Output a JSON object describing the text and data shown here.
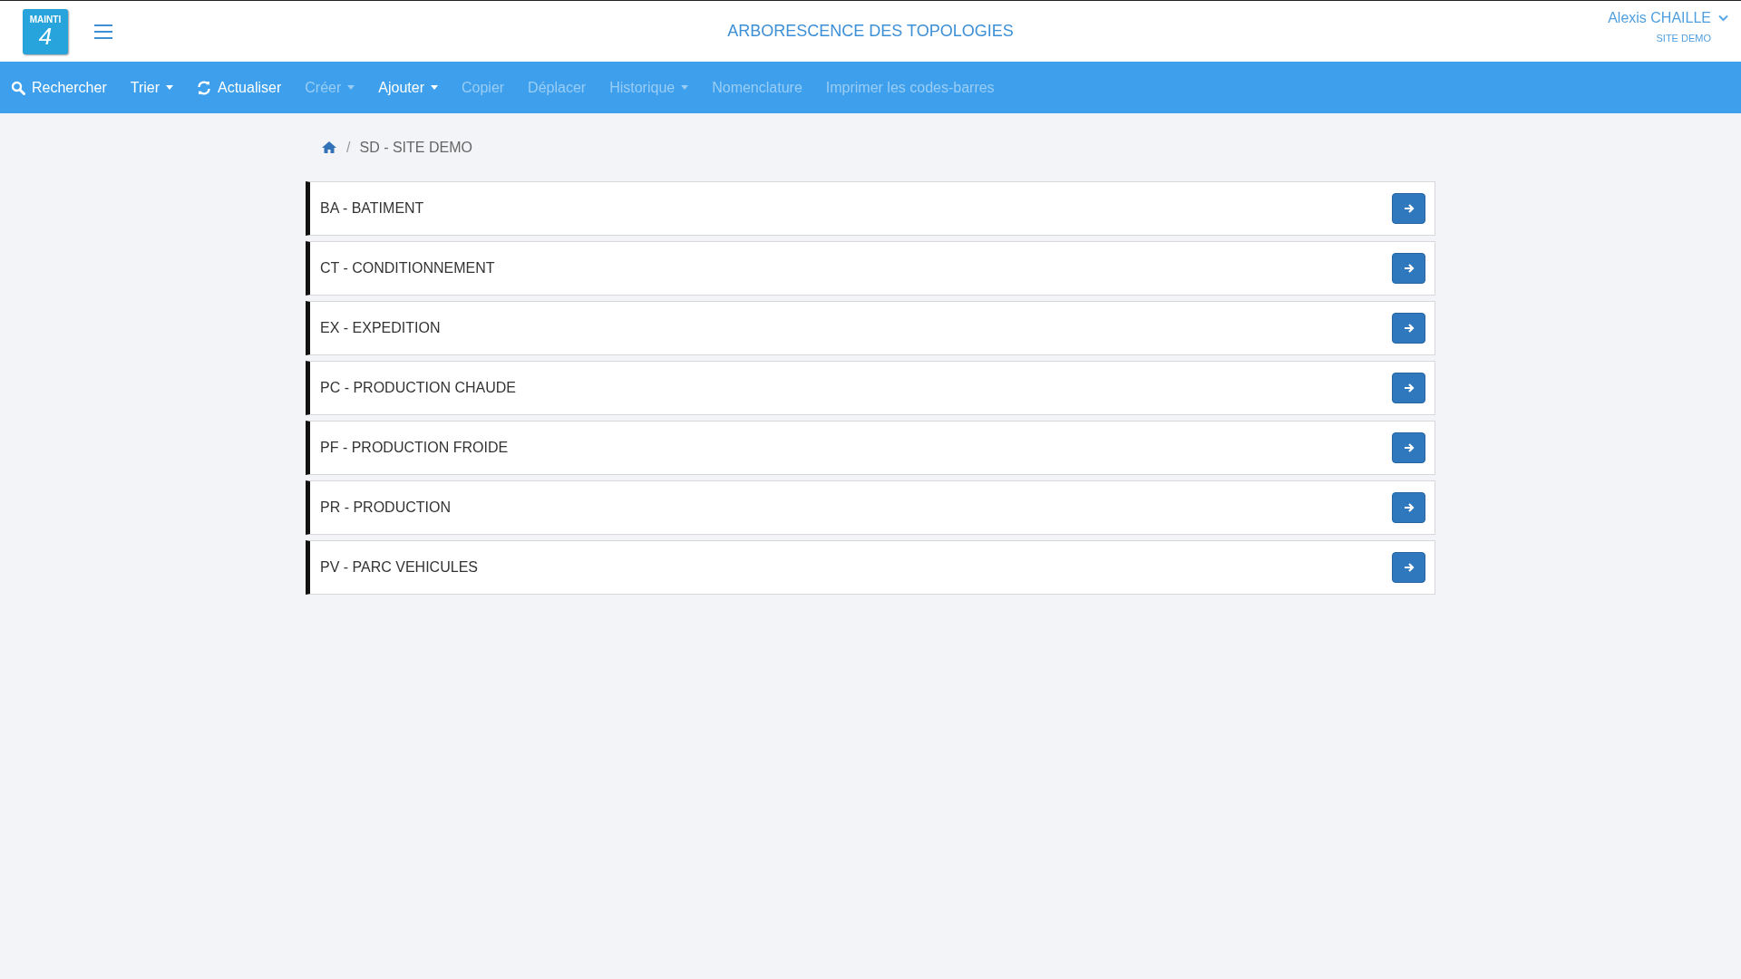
{
  "header": {
    "logo": {
      "text": "MAINTI",
      "number": "4"
    },
    "title": "ARBORESCENCE DES TOPOLOGIES",
    "user": {
      "name": "Alexis CHAILLE",
      "site": "SITE DEMO"
    }
  },
  "toolbar": [
    {
      "label": "Rechercher",
      "kind": "search",
      "dropdown": false,
      "disabled": false
    },
    {
      "label": "Trier",
      "kind": "plain",
      "dropdown": true,
      "disabled": false
    },
    {
      "label": "Actualiser",
      "kind": "refresh",
      "dropdown": false,
      "disabled": false
    },
    {
      "label": "Créer",
      "kind": "plain",
      "dropdown": true,
      "disabled": true
    },
    {
      "label": "Ajouter",
      "kind": "plain",
      "dropdown": true,
      "disabled": false
    },
    {
      "label": "Copier",
      "kind": "plain",
      "dropdown": false,
      "disabled": true
    },
    {
      "label": "Déplacer",
      "kind": "plain",
      "dropdown": false,
      "disabled": true
    },
    {
      "label": "Historique",
      "kind": "plain",
      "dropdown": true,
      "disabled": true
    },
    {
      "label": "Nomenclature",
      "kind": "plain",
      "dropdown": false,
      "disabled": true
    },
    {
      "label": "Imprimer les codes-barres",
      "kind": "plain",
      "dropdown": false,
      "disabled": true
    }
  ],
  "breadcrumb": {
    "separator": "/",
    "items": [
      "SD - SITE DEMO"
    ]
  },
  "items": [
    {
      "label": "BA - BATIMENT"
    },
    {
      "label": "CT - CONDITIONNEMENT"
    },
    {
      "label": "EX - EXPEDITION"
    },
    {
      "label": "PC - PRODUCTION CHAUDE"
    },
    {
      "label": "PF - PRODUCTION FROIDE"
    },
    {
      "label": "PR - PRODUCTION"
    },
    {
      "label": "PV - PARC VEHICULES"
    }
  ]
}
